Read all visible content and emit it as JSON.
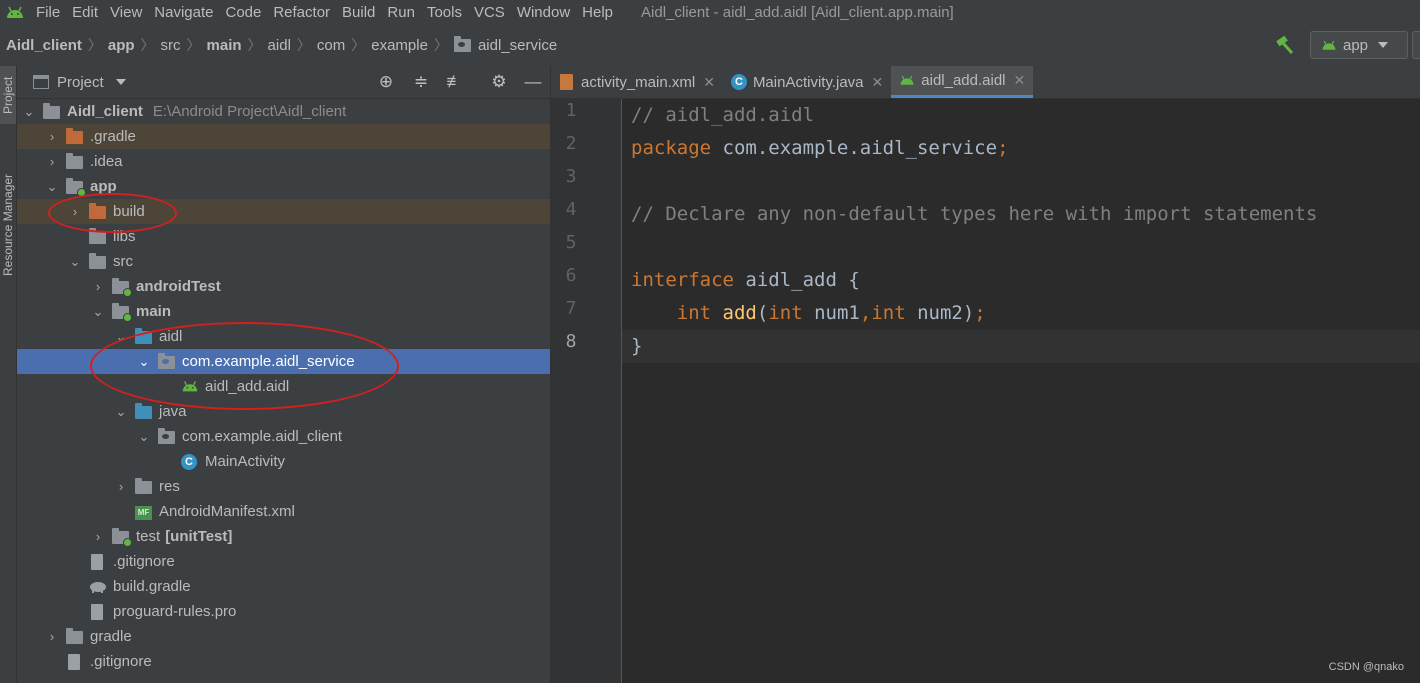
{
  "menubar": {
    "items": [
      "File",
      "Edit",
      "View",
      "Navigate",
      "Code",
      "Refactor",
      "Build",
      "Run",
      "Tools",
      "VCS",
      "Window",
      "Help"
    ],
    "window_title": "Aidl_client - aidl_add.aidl [Aidl_client.app.main]"
  },
  "breadcrumb": [
    "Aidl_client",
    "app",
    "src",
    "main",
    "aidl",
    "com",
    "example",
    "aidl_service"
  ],
  "run_config": {
    "label": "app"
  },
  "side_tabs": {
    "project": "Project",
    "resource_manager": "Resource Manager"
  },
  "project_panel": {
    "title": "Project",
    "tree": [
      {
        "label": "Aidl_client",
        "path": "E:\\Android Project\\Aidl_client"
      },
      {
        "label": ".gradle"
      },
      {
        "label": ".idea"
      },
      {
        "label": "app"
      },
      {
        "label": "build"
      },
      {
        "label": "libs"
      },
      {
        "label": "src"
      },
      {
        "label": "androidTest"
      },
      {
        "label": "main"
      },
      {
        "label": "aidl"
      },
      {
        "label": "com.example.aidl_service"
      },
      {
        "label": "aidl_add.aidl"
      },
      {
        "label": "java"
      },
      {
        "label": "com.example.aidl_client"
      },
      {
        "label": "MainActivity"
      },
      {
        "label": "res"
      },
      {
        "label": "AndroidManifest.xml"
      },
      {
        "label": "test",
        "suffix": "[unitTest]"
      },
      {
        "label": ".gitignore"
      },
      {
        "label": "build.gradle"
      },
      {
        "label": "proguard-rules.pro"
      },
      {
        "label": "gradle"
      },
      {
        "label": ".gitignore"
      }
    ]
  },
  "editor": {
    "tabs": [
      {
        "label": "activity_main.xml"
      },
      {
        "label": "MainActivity.java"
      },
      {
        "label": "aidl_add.aidl"
      }
    ],
    "line_numbers": [
      "1",
      "2",
      "3",
      "4",
      "5",
      "6",
      "7",
      "8"
    ],
    "code": {
      "l1_comment": "// aidl_add.aidl",
      "l2_kw": "package",
      "l2_rest": " com.example.aidl_service",
      "l2_semi": ";",
      "l4_comment": "// Declare any non-default types here with import statements",
      "l6_kw": "interface",
      "l6_rest": " aidl_add {",
      "l7_indent": "    ",
      "l7_kw1": "int",
      "l7_sp": " ",
      "l7_fn": "add",
      "l7_paren": "(",
      "l7_kw2": "int",
      "l7_p1": " num1",
      "l7_comma": ",",
      "l7_kw3": "int",
      "l7_p2": " num2)",
      "l7_semi": ";",
      "l8": "}"
    }
  },
  "watermark": "CSDN @qnako",
  "colors": {
    "selection": "#4b6eaf",
    "annotation": "#d41f1f",
    "keyword": "#cc7832",
    "comment": "#808080",
    "function": "#ffc66d"
  }
}
